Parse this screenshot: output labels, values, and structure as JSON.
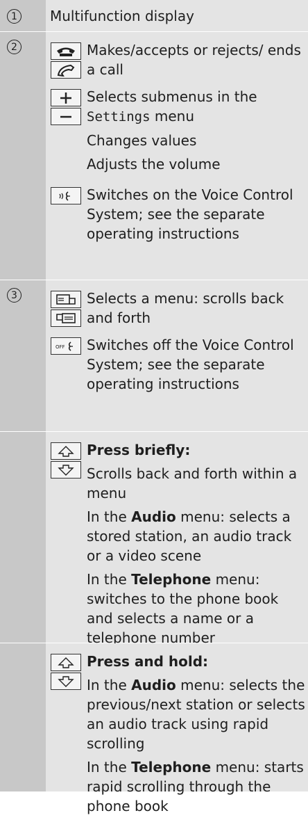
{
  "rows": [
    {
      "num": "1",
      "text": "Multifunction display"
    },
    {
      "num": "2",
      "items": [
        {
          "icons": [
            "phone-accept-icon",
            "phone-end-icon"
          ],
          "text": "Makes/accepts or rejects/ ends a call"
        },
        {
          "icons": [
            "plus-icon",
            "minus-icon"
          ],
          "text_a": "Selects submenus in the",
          "mono": "Settings",
          "text_b": "menu",
          "p2": "Changes values",
          "p3": "Adjusts the volume"
        },
        {
          "icons": [
            "voice-on-icon"
          ],
          "text": "Switches on the Voice Control System; see the separate operating instructions"
        }
      ]
    },
    {
      "num": "3",
      "items": [
        {
          "icons": [
            "menu-back-icon",
            "menu-forward-icon"
          ],
          "text": "Selects a menu: scrolls back and forth"
        },
        {
          "icons": [
            "voice-off-icon"
          ],
          "text": "Switches off the Voice Control System; see the separate operating instructions"
        }
      ]
    },
    {
      "num": "",
      "heading": "Press briefly:",
      "p1": "Scrolls back and forth within a menu",
      "p2_a": "In the",
      "p2_b": "Audio",
      "p2_c": "menu: selects a stored station, an audio track or a video scene",
      "p3_a": "In the",
      "p3_b": "Telephone",
      "p3_c": "menu: switches to the phone book and selects a name or a telephone number"
    },
    {
      "num": "",
      "heading": "Press and hold:",
      "p1_a": "In the",
      "p1_b": "Audio",
      "p1_c": "menu: selects the previous/next station or selects an audio track using rapid scrolling",
      "p2_a": "In the",
      "p2_b": "Telephone",
      "p2_c": "menu: starts rapid scrolling through the phone book"
    }
  ],
  "key_icons": {
    "up": "arrow-up-icon",
    "down": "arrow-down-icon",
    "voice_off_label": "OFF"
  }
}
